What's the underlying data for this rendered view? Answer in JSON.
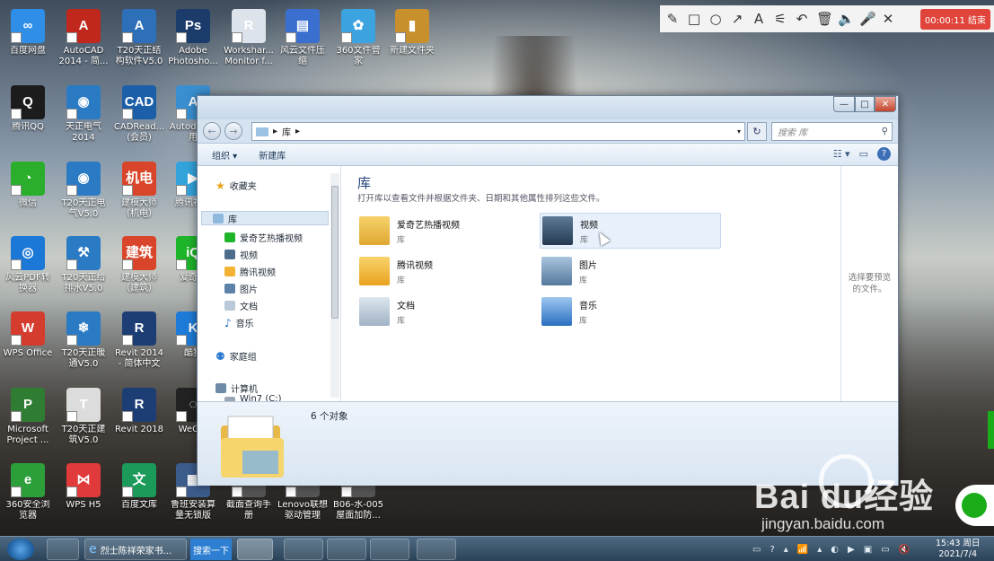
{
  "recorder": {
    "tools": [
      "✎",
      "□",
      "○",
      "↗",
      "A",
      "⚟",
      "↶",
      "🗑",
      "🔈",
      "🎤",
      "✕"
    ],
    "time": "00:00:11 结束"
  },
  "desktop_icons": [
    {
      "label": "百度网盘",
      "color": "#2f8fe8",
      "glyph": "∞"
    },
    {
      "label": "AutoCAD 2014 - 简...",
      "color": "#c0281d",
      "glyph": "A"
    },
    {
      "label": "T20天正结构软件V5.0",
      "color": "#2d6fb8",
      "glyph": "A"
    },
    {
      "label": "Adobe Photosho...",
      "color": "#1b3b6b",
      "glyph": "Ps"
    },
    {
      "label": "Workshar... Monitor f...",
      "color": "#dde3ea",
      "glyph": "R"
    },
    {
      "label": "风云文件压缩",
      "color": "#3a6fd0",
      "glyph": "▤"
    },
    {
      "label": "360文件管家",
      "color": "#3aa3e0",
      "glyph": "✿"
    },
    {
      "label": "新建文件夹",
      "color": "#c8902c",
      "glyph": "▮"
    },
    {
      "label": "腾讯QQ",
      "color": "#1c1c1c",
      "glyph": "Q"
    },
    {
      "label": "天正电气2014",
      "color": "#2b7bc4",
      "glyph": "◉"
    },
    {
      "label": "CADRead... (会员)",
      "color": "#1b5fa8",
      "glyph": "CAD"
    },
    {
      "label": "Autod... 使用",
      "color": "#3a8fd0",
      "glyph": "A"
    },
    {
      "label": "微信",
      "color": "#2bae2b",
      "glyph": "◔"
    },
    {
      "label": "T20天正电气V5.0",
      "color": "#2b7bc4",
      "glyph": "◉"
    },
    {
      "label": "建模大师（机电）",
      "color": "#d8452a",
      "glyph": "机电"
    },
    {
      "label": "腾讯视频",
      "color": "#33a3dc",
      "glyph": "▶"
    },
    {
      "label": "风云PDF转换器",
      "color": "#1c78d6",
      "glyph": "◎"
    },
    {
      "label": "T20天正给排水V5.0",
      "color": "#2b7bc4",
      "glyph": "⚒"
    },
    {
      "label": "建模大师（建筑）",
      "color": "#d8452a",
      "glyph": "建筑"
    },
    {
      "label": "爱奇艺",
      "color": "#1fb52a",
      "glyph": "iQ"
    },
    {
      "label": "WPS Office",
      "color": "#d43c2e",
      "glyph": "W"
    },
    {
      "label": "T20天正暖通V5.0",
      "color": "#2b7bc4",
      "glyph": "❄"
    },
    {
      "label": "Revit 2014 - 简体中文 (...",
      "color": "#1d3e74",
      "glyph": "R"
    },
    {
      "label": "酷狗",
      "color": "#1e7cd8",
      "glyph": "K"
    },
    {
      "label": "Microsoft Project ...",
      "color": "#2e7d32",
      "glyph": "P"
    },
    {
      "label": "T20天正建筑V5.0",
      "color": "#dcdcdc",
      "glyph": "T"
    },
    {
      "label": "Revit 2018",
      "color": "#1d3e74",
      "glyph": "R"
    },
    {
      "label": "WeG...",
      "color": "#222",
      "glyph": "◌"
    },
    {
      "label": "360安全浏览器",
      "color": "#2c9e3a",
      "glyph": "e"
    },
    {
      "label": "WPS H5",
      "color": "#e03a3a",
      "glyph": "⋈"
    },
    {
      "label": "百度文库",
      "color": "#1b9a5a",
      "glyph": "文"
    },
    {
      "label": "鲁班安装算量无锁版",
      "color": "#3c5c8c",
      "glyph": "▦"
    },
    {
      "label": "截面查询手册",
      "color": "#555",
      "glyph": ""
    },
    {
      "label": "Lenovo联想驱动管理",
      "color": "#555",
      "glyph": ""
    },
    {
      "label": "B06-水-005屋面加防...",
      "color": "#555",
      "glyph": ""
    }
  ],
  "window": {
    "controls": {
      "minimize": "—",
      "maximize": "□",
      "close": "✕"
    },
    "back": "←",
    "forward": "→",
    "address": {
      "path": "库",
      "sep": "▸",
      "dropdown": "▾"
    },
    "refresh": "↻",
    "search_placeholder": "搜索 库",
    "search_icon": "⚲",
    "toolbar": {
      "organize": "组织 ▾",
      "new_library": "新建库",
      "view": "☷ ▾",
      "pane": "▭",
      "help": "?"
    },
    "nav": {
      "favorites": "收藏夹",
      "libraries": "库",
      "lib_items": [
        "爱奇艺热播视频",
        "视频",
        "腾讯视频",
        "图片",
        "文档",
        "音乐"
      ],
      "homegroup": "家庭组",
      "computer": "计算机",
      "drive": "Win7 (C:)"
    },
    "content": {
      "title": "库",
      "subtitle": "打开库以查看文件并根据文件夹、日期和其他属性排列这些文件。",
      "libraries": [
        {
          "name": "爱奇艺热播视频",
          "type": "库"
        },
        {
          "name": "视频",
          "type": "库"
        },
        {
          "name": "腾讯视频",
          "type": "库"
        },
        {
          "name": "图片",
          "type": "库"
        },
        {
          "name": "文档",
          "type": "库"
        },
        {
          "name": "音乐",
          "type": "库"
        }
      ]
    },
    "preview_text": "选择要预览的文件。",
    "status_count": "6 个对象"
  },
  "taskbar": {
    "ie_label": "烈士陈祥荣家书...",
    "search_button": "搜索一下",
    "tray_icons": [
      "▭",
      "?",
      "▴",
      "📶",
      "▴",
      "◐",
      "▶",
      "▣",
      "▭",
      "🔇"
    ],
    "clock_time": "15:43 周日",
    "clock_date": "2021/7/4"
  },
  "watermark": {
    "brand": "Bai  du经验",
    "url": "jingyan.baidu.com"
  }
}
